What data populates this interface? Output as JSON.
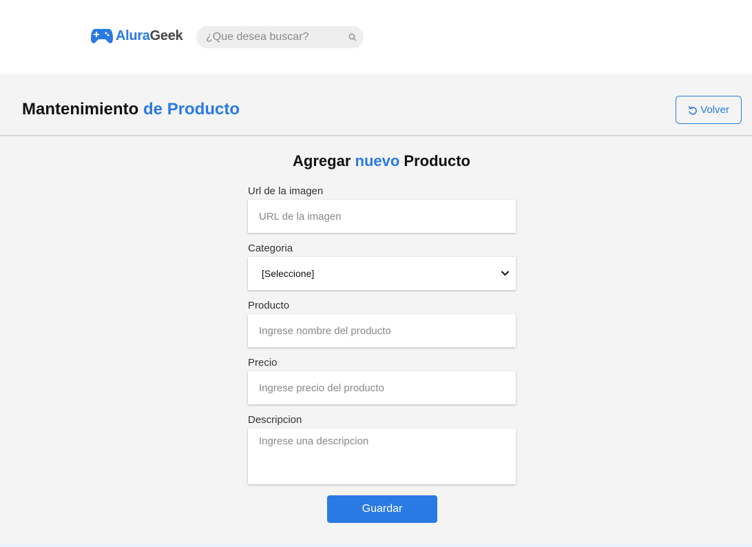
{
  "header": {
    "logo": {
      "part1": "Alura",
      "part2": "Geek",
      "icon": "gamepad-icon"
    },
    "search": {
      "placeholder": "¿Que desea buscar?",
      "icon": "search-icon"
    }
  },
  "page": {
    "title_part1": "Mantenimiento",
    "title_part2": "de Producto",
    "back_label": "Volver",
    "back_icon": "undo-icon"
  },
  "form": {
    "title_part1": "Agregar",
    "title_part2": "nuevo",
    "title_part3": "Producto",
    "fields": {
      "image_url": {
        "label": "Url de la imagen",
        "placeholder": "URL de la imagen",
        "value": ""
      },
      "category": {
        "label": "Categoria",
        "selected": "[Seleccione]"
      },
      "product": {
        "label": "Producto",
        "placeholder": "Ingrese nombre del producto",
        "value": ""
      },
      "price": {
        "label": "Precio",
        "placeholder": "Ingrese precio del producto",
        "value": ""
      },
      "description": {
        "label": "Descripcion",
        "placeholder": "Ingrese una descripcion",
        "value": ""
      }
    },
    "submit_label": "Guardar"
  },
  "colors": {
    "accent": "#2a7ae4",
    "dark_text": "#464646",
    "background": "#f4f4f4"
  }
}
